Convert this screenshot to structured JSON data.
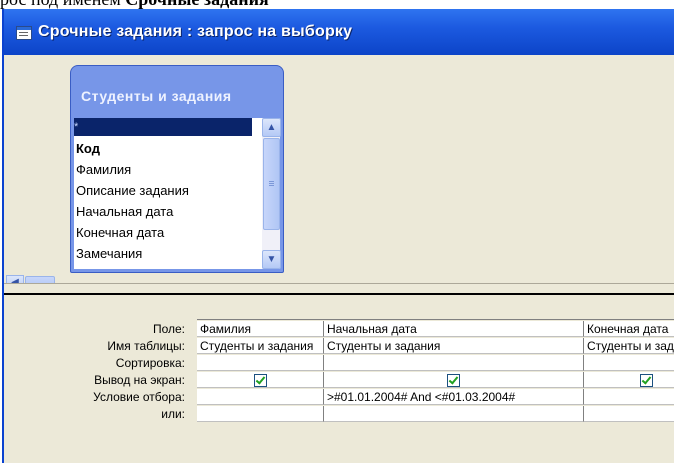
{
  "caption": {
    "prefix": "рос под именем ",
    "bold": "Срочные задания"
  },
  "window": {
    "title": "Срочные задания : запрос на выборку",
    "app_icon": "query-icon"
  },
  "table": {
    "title": "Студенты и задания",
    "fields": [
      "*",
      "Код",
      "Фамилия",
      "Описание задания",
      "Начальная дата",
      "Конечная дата",
      "Замечания"
    ]
  },
  "scroll": {
    "up": "▲",
    "down": "▼",
    "left": "◀"
  },
  "grid": {
    "row_labels": [
      "Поле:",
      "Имя таблицы:",
      "Сортировка:",
      "Вывод на экран:",
      "Условие отбора:",
      "или:"
    ],
    "columns": [
      {
        "field": "Фамилия",
        "table": "Студенты и задания",
        "sort": "",
        "show": true,
        "criteria": "",
        "or": ""
      },
      {
        "field": "Начальная дата",
        "table": "Студенты и задания",
        "sort": "",
        "show": true,
        "criteria": ">#01.01.2004# And <#01.03.2004#",
        "or": ""
      },
      {
        "field": "Конечная дата",
        "table": "Студенты и задания",
        "sort": "",
        "show": true,
        "criteria": "",
        "or": ""
      }
    ]
  }
}
